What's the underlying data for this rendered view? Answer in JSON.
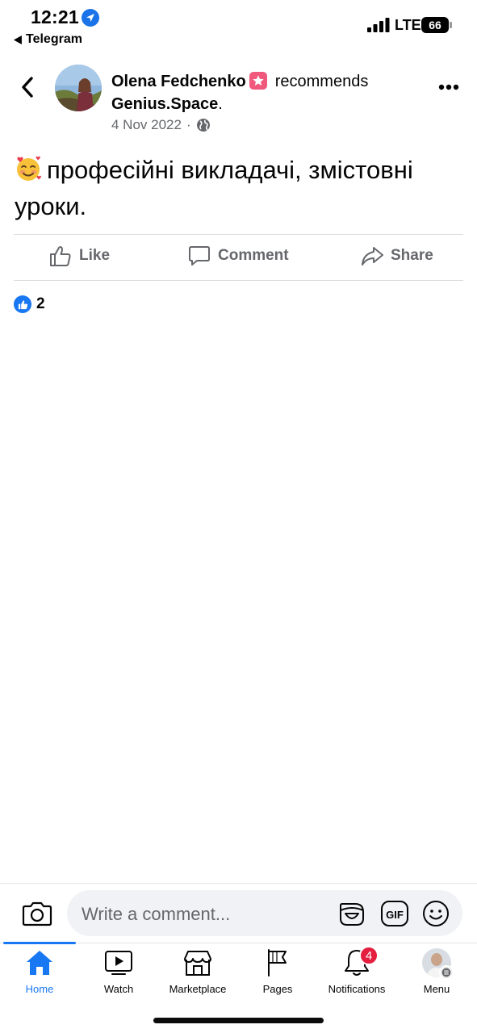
{
  "status_bar": {
    "time": "12:21",
    "back_app": "Telegram",
    "network": "LTE",
    "battery": "66"
  },
  "post": {
    "author": "Olena Fedchenko",
    "action": "recommends",
    "page": "Genius.Space",
    "page_suffix": ".",
    "date": "4 Nov 2022",
    "separator": "·",
    "text": "професійні викладачі, змістовні уроки.",
    "emoji": "smiling-face-with-hearts-icon",
    "like_count": "2"
  },
  "actions": {
    "like": "Like",
    "comment": "Comment",
    "share": "Share"
  },
  "comment_bar": {
    "placeholder": "Write a comment..."
  },
  "tabs": [
    {
      "label": "Home",
      "icon": "home-icon",
      "active": true
    },
    {
      "label": "Watch",
      "icon": "watch-icon"
    },
    {
      "label": "Marketplace",
      "icon": "marketplace-icon"
    },
    {
      "label": "Pages",
      "icon": "pages-flag-icon"
    },
    {
      "label": "Notifications",
      "icon": "bell-icon",
      "badge": "4"
    },
    {
      "label": "Menu",
      "icon": "profile-avatar"
    }
  ],
  "colors": {
    "accent": "#1877f2",
    "badge": "#e41e3f",
    "secondary_text": "#65676b",
    "star_badge": "#f0587c"
  }
}
